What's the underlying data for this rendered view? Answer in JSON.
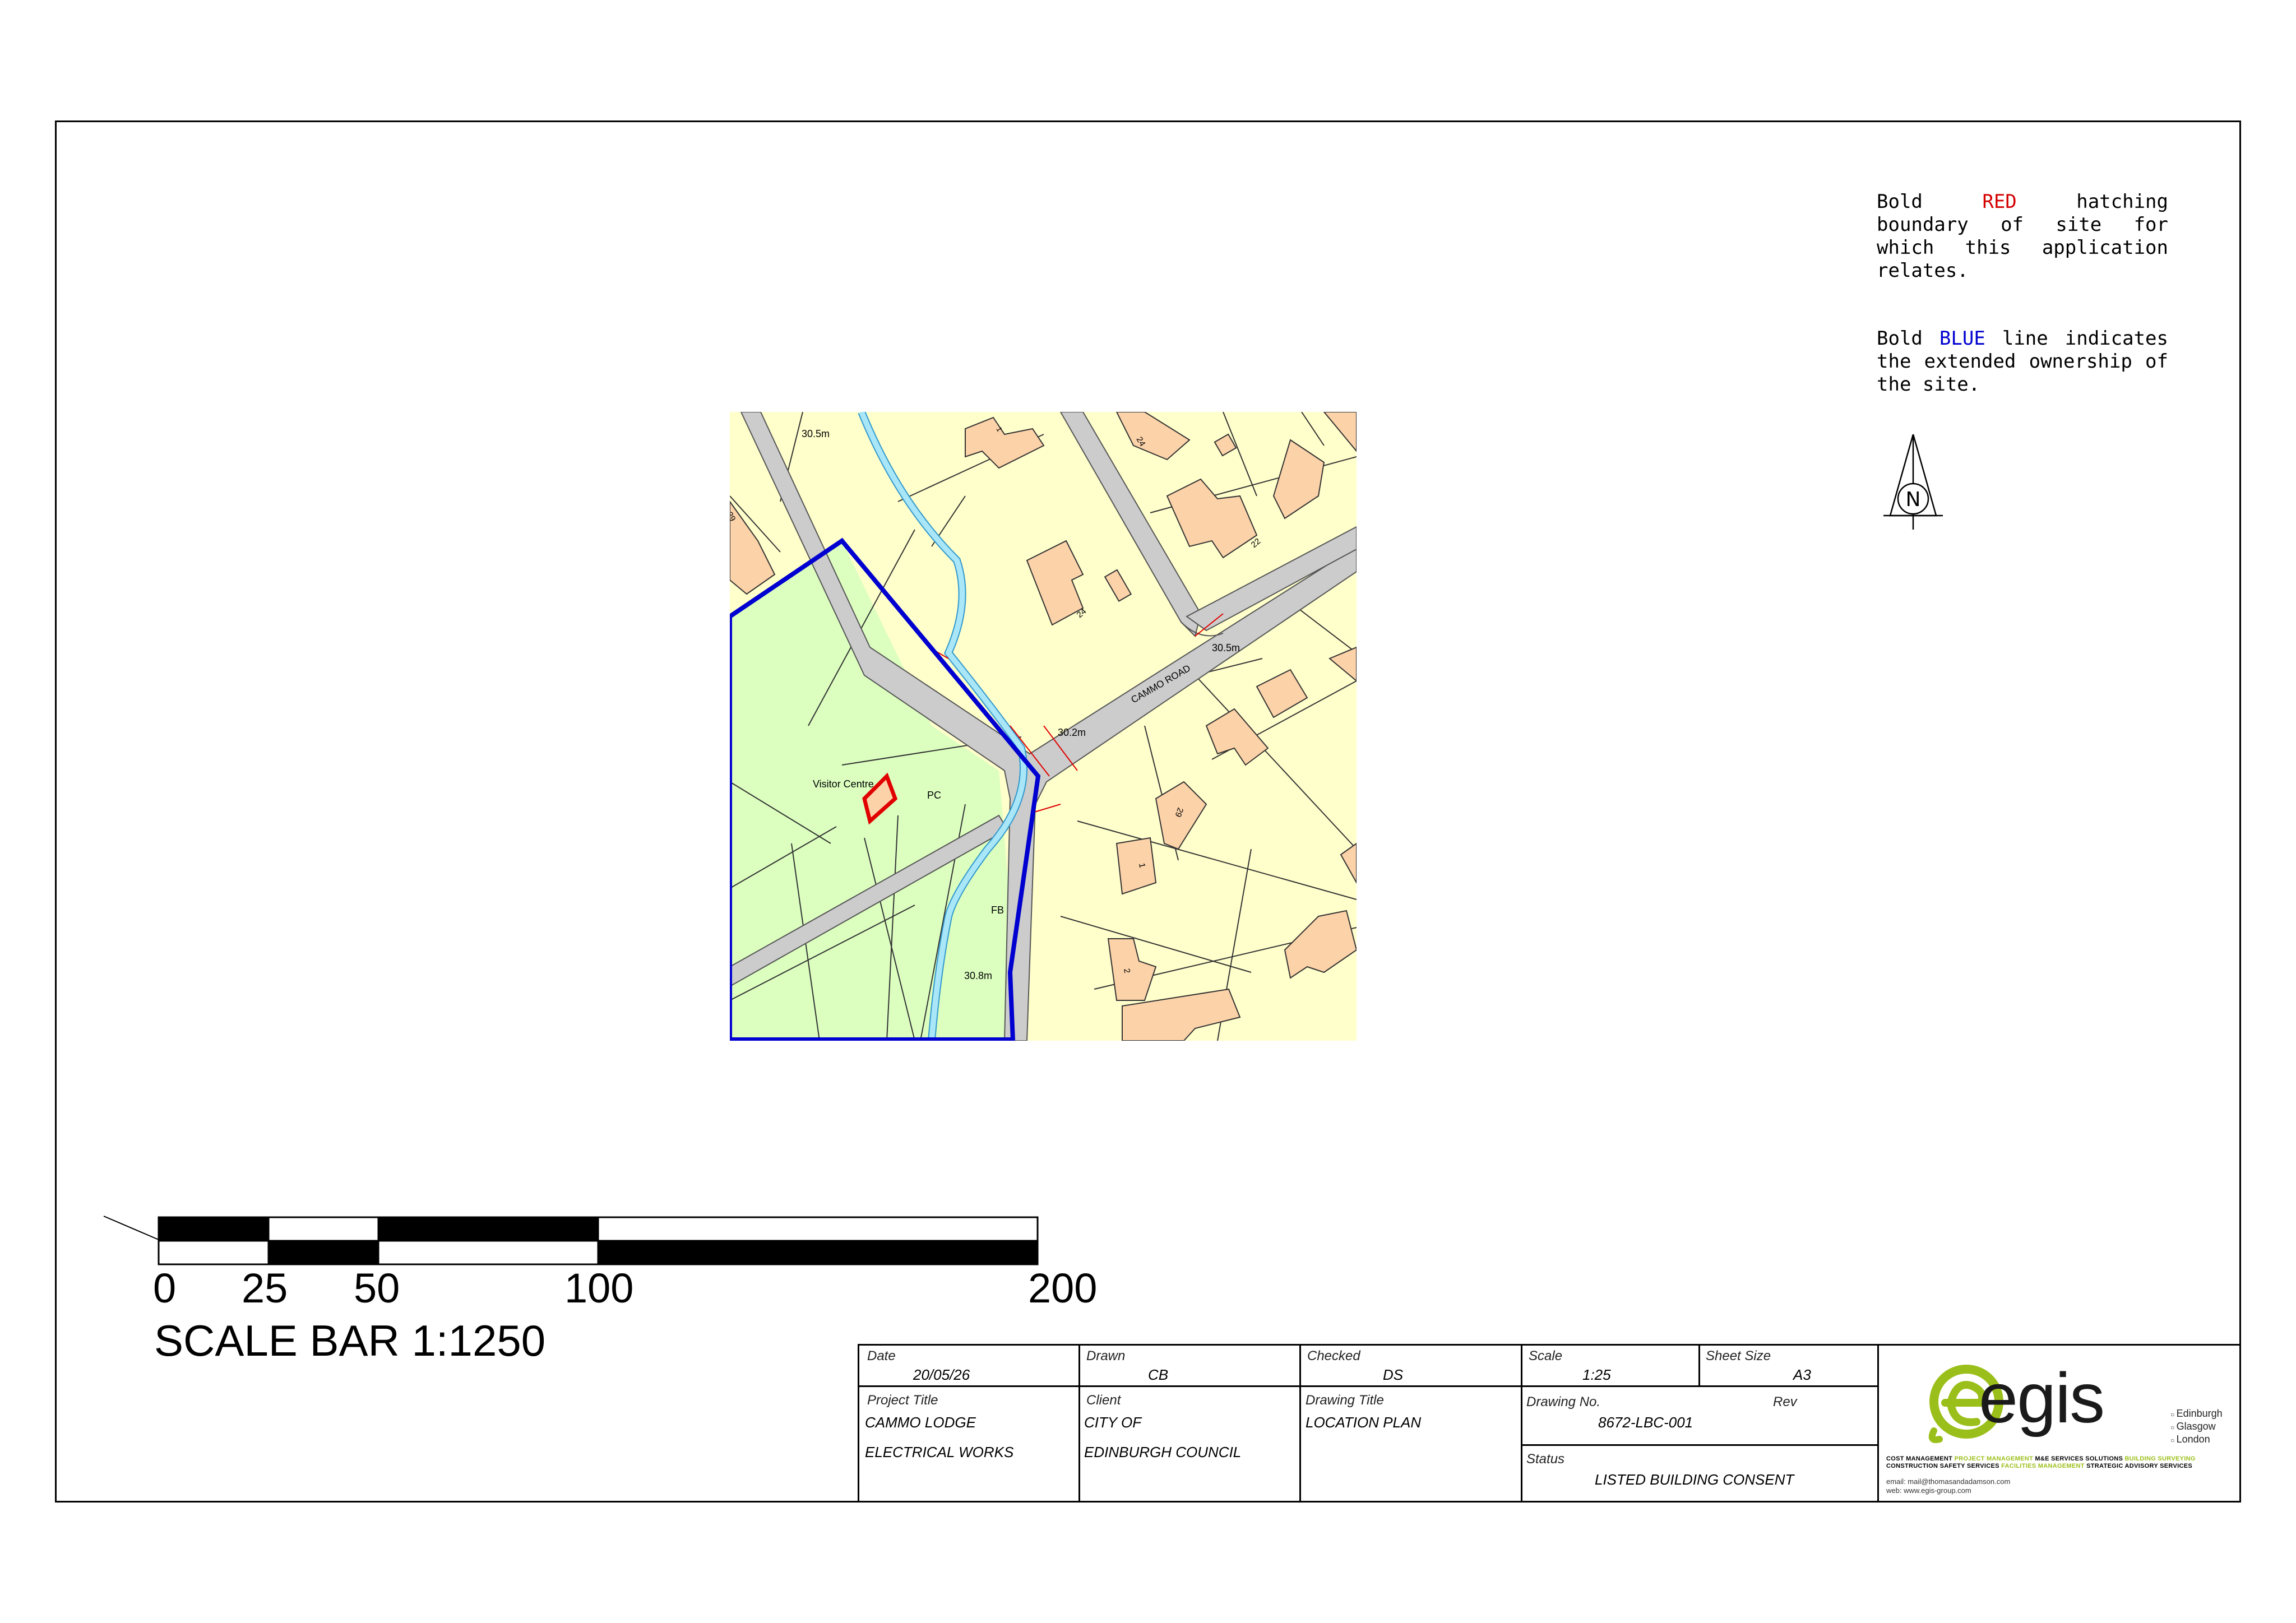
{
  "legend": {
    "red_pre": "Bold ",
    "red_word": "RED",
    "red_post": " hatching boundary of site for which this application relates.",
    "blue_pre": "Bold ",
    "blue_word": "BLUE",
    "blue_post": " line indicates the extended ownership of the site.",
    "red_color": "#d40000",
    "blue_color": "#0000d0"
  },
  "north_arrow": {
    "letter": "N",
    "icon": "north-arrow-icon"
  },
  "map": {
    "labels": {
      "road": "CAMMO ROAD",
      "level_1": "30.5m",
      "level_2": "30.5m",
      "level_3": "30.2m",
      "level_4": "30.8m",
      "visitor_centre": "Visitor Centre",
      "pc": "PC",
      "fb": "FB",
      "house_24": "24",
      "house_22": "22",
      "house_1": "1",
      "house_2": "2",
      "house_29": "29",
      "house_24b": "24",
      "house_1b": "1",
      "house_29b": "29"
    },
    "colors": {
      "residential": "#ffffcc",
      "parkland": "#dcffc0",
      "road": "#cccccc",
      "building": "#fcd2a8",
      "water": "#a8e6f8",
      "site_boundary": "#e00000",
      "ownership_boundary": "#0000d0"
    }
  },
  "scale_bar": {
    "ticks": [
      "0",
      "25",
      "50",
      "100",
      "200"
    ],
    "title": "SCALE BAR 1:1250"
  },
  "title_block": {
    "date_label": "Date",
    "date": "20/05/26",
    "drawn_label": "Drawn",
    "drawn": "CB",
    "checked_label": "Checked",
    "checked": "DS",
    "scale_label": "Scale",
    "scale": "1:25",
    "sheet_label": "Sheet Size",
    "sheet": "A3",
    "project_label": "Project Title",
    "project_1": "CAMMO LODGE",
    "project_2": "ELECTRICAL WORKS",
    "client_label": "Client",
    "client_1": "CITY OF",
    "client_2": "EDINBURGH COUNCIL",
    "drawing_title_label": "Drawing Title",
    "drawing_title": "LOCATION PLAN",
    "drawing_no_label": "Drawing No.",
    "drawing_no": "8672-LBC-001",
    "rev_label": "Rev",
    "status_label": "Status",
    "status": "LISTED BUILDING CONSENT"
  },
  "company": {
    "name": "egis",
    "offices": [
      "Edinburgh",
      "Glasgow",
      "London"
    ],
    "services": [
      {
        "text": "COST MANAGEMENT ",
        "green": false
      },
      {
        "text": "PROJECT MANAGEMENT ",
        "green": true
      },
      {
        "text": "M&E SERVICES ",
        "green": false
      },
      {
        "text": "SOLUTIONS ",
        "green": false
      },
      {
        "text": "BUILDING SURVEYING ",
        "green": true
      },
      {
        "text": "CONSTRUCTION SAFETY SERVICES ",
        "green": false
      },
      {
        "text": "FACILITIES MANAGEMENT ",
        "green": true
      },
      {
        "text": "STRATEGIC ADVISORY SERVICES",
        "green": false
      }
    ],
    "email": "email: mail@thomasandadamson.com",
    "web": "web: www.egis-group.com",
    "brand_color": "#9bbf1a"
  }
}
